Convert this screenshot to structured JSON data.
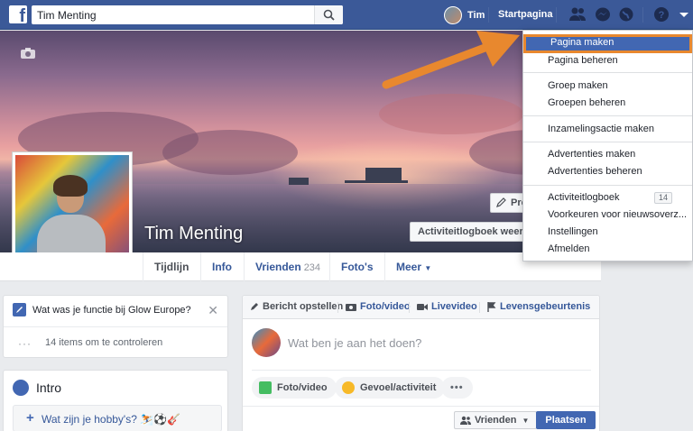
{
  "topbar": {
    "search_value": "Tim Menting",
    "user_name": "Tim",
    "home_label": "Startpagina"
  },
  "profile": {
    "name": "Tim Menting",
    "update_info_label": "Pro",
    "activity_log_label": "Activiteitlogboek weergev"
  },
  "nav": {
    "tabs": [
      {
        "label": "Tijdlijn"
      },
      {
        "label": "Info"
      },
      {
        "label": "Vrienden",
        "count": "234"
      },
      {
        "label": "Foto's"
      },
      {
        "label": "Meer"
      }
    ]
  },
  "question_card": {
    "question": "Wat was je functie bij Glow Europe?",
    "dots": "···",
    "items_text": "14 items om te controleren"
  },
  "intro": {
    "title": "Intro",
    "hobbies_prompt": "Wat zijn je hobby's? ⛷️⚽🎸"
  },
  "composer": {
    "tabs": [
      {
        "label": "Bericht opstellen"
      },
      {
        "label": "Foto/video"
      },
      {
        "label": "Livevideo"
      },
      {
        "label": "Levensgebeurtenis"
      }
    ],
    "placeholder": "Wat ben je aan het doen?",
    "actions": [
      {
        "label": "Foto/video",
        "color": "#45bd62"
      },
      {
        "label": "Gevoel/activiteit",
        "color": "#f7b928"
      },
      {
        "label": "•••"
      }
    ],
    "audience_label": "Vrienden",
    "post_label": "Plaatsen"
  },
  "dropdown": {
    "items": [
      {
        "label": "Pagina maken"
      },
      {
        "label": "Pagina beheren"
      },
      {
        "label": "Groep maken"
      },
      {
        "label": "Groepen beheren"
      },
      {
        "label": "Inzamelingsactie maken"
      },
      {
        "label": "Advertenties maken"
      },
      {
        "label": "Advertenties beheren"
      },
      {
        "label": "Activiteitlogboek",
        "badge": "14"
      },
      {
        "label": "Voorkeuren voor nieuwsoverz..."
      },
      {
        "label": "Instellingen"
      },
      {
        "label": "Afmelden"
      }
    ]
  },
  "colors": {
    "brand": "#3b5998",
    "accent": "#4267b2",
    "highlight_border": "#e8882e"
  }
}
